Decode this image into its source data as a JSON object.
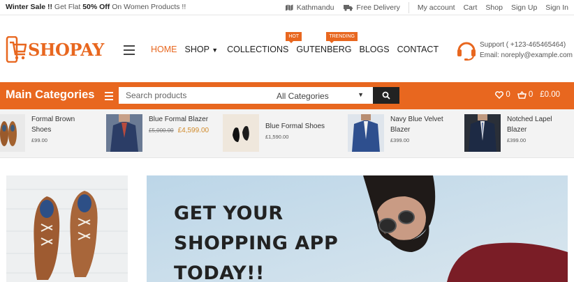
{
  "topbar": {
    "promo_bold": "Winter Sale !!",
    "promo_mid": "Get Flat",
    "promo_discount": "50% Off",
    "promo_tail": "On Women Products !!",
    "location": "Kathmandu",
    "delivery": "Free Delivery",
    "links": [
      "My account",
      "Cart",
      "Shop",
      "Sign Up",
      "Sign In"
    ]
  },
  "brand": {
    "name": "SHOPAY",
    "color": "#e8671f"
  },
  "nav": {
    "items": [
      "HOME",
      "SHOP",
      "COLLECTIONS",
      "GUTENBERG",
      "BLOGS",
      "CONTACT"
    ],
    "badge_hot": "HOT",
    "badge_trending": "TRENDING"
  },
  "support": {
    "phone": "Support ( +123-465465464)",
    "email": "Email: noreply@example.com"
  },
  "categories_bar": {
    "title": "Main Categories",
    "search_placeholder": "Search products",
    "category_select": "All Categories",
    "wishlist_count": "0",
    "cart_count": "0",
    "cart_total": "£0.00"
  },
  "products": [
    {
      "name": "Formal Brown Shoes",
      "price": "£99.00",
      "old_price": "",
      "image": "brown-shoes"
    },
    {
      "name": "Blue Formal Blazer",
      "price": "£4,599.00",
      "old_price": "£5,000.00",
      "image": "blue-blazer"
    },
    {
      "name": "Blue Formal Shoes",
      "price": "£1,590.00",
      "old_price": "",
      "image": "black-shoes"
    },
    {
      "name": "Navy Blue Velvet Blazer",
      "price": "£399.00",
      "old_price": "",
      "image": "navy-blazer"
    },
    {
      "name": "Notched Lapel Blazer",
      "price": "£399.00",
      "old_price": "",
      "image": "lapel-blazer"
    }
  ],
  "hero": {
    "line1": "GET YOUR",
    "line2": "SHOPPING APP",
    "line3": "TODAY!!"
  }
}
